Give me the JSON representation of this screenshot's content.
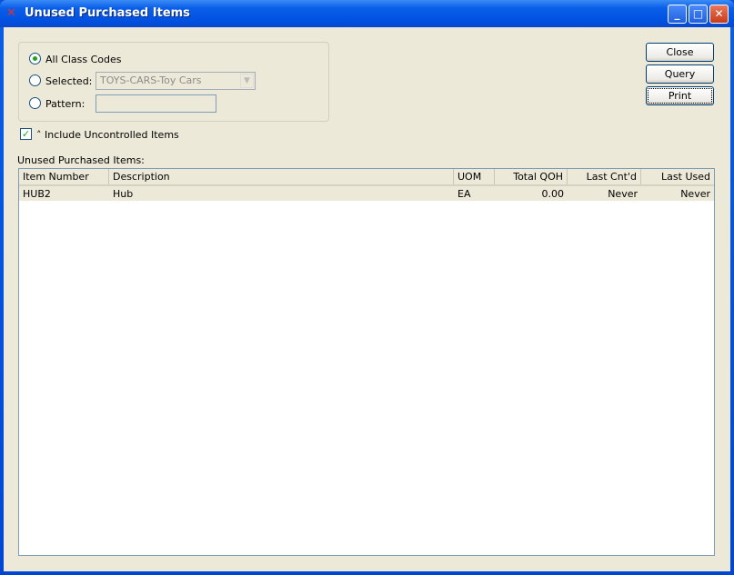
{
  "window": {
    "title": "Unused Purchased Items"
  },
  "filters": {
    "all_label": "All Class Codes",
    "selected_label": "Selected:",
    "selected_value": "TOYS-CARS-Toy Cars",
    "pattern_label": "Pattern:",
    "pattern_value": "",
    "include_uncontrolled_label": "Include Uncontrolled Items",
    "include_uncontrolled_checked": true,
    "mode": "all"
  },
  "buttons": {
    "close": "Close",
    "query": "Query",
    "print": "Print"
  },
  "table": {
    "label": "Unused Purchased Items:",
    "columns": [
      "Item Number",
      "Description",
      "UOM",
      "Total QOH",
      "Last Cnt'd",
      "Last Used"
    ],
    "rows": [
      [
        "HUB2",
        "Hub",
        "EA",
        "0.00",
        "Never",
        "Never"
      ]
    ]
  }
}
